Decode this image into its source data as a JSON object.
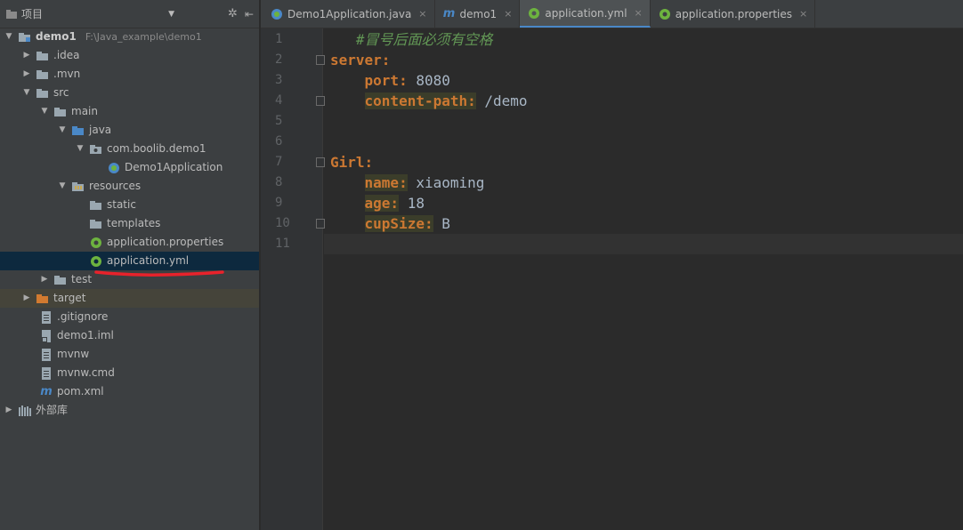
{
  "sidebar": {
    "title": "项目",
    "root": {
      "name": "demo1",
      "path": "F:\\Java_example\\demo1"
    },
    "items": [
      {
        "label": ".idea"
      },
      {
        "label": ".mvn"
      },
      {
        "label": "src"
      },
      {
        "label": "main"
      },
      {
        "label": "java"
      },
      {
        "label": "com.boolib.demo1"
      },
      {
        "label": "Demo1Application"
      },
      {
        "label": "resources"
      },
      {
        "label": "static"
      },
      {
        "label": "templates"
      },
      {
        "label": "application.properties"
      },
      {
        "label": "application.yml"
      },
      {
        "label": "test"
      },
      {
        "label": "target"
      },
      {
        "label": ".gitignore"
      },
      {
        "label": "demo1.iml"
      },
      {
        "label": "mvnw"
      },
      {
        "label": "mvnw.cmd"
      },
      {
        "label": "pom.xml"
      },
      {
        "label": "外部库"
      }
    ]
  },
  "tabs": [
    {
      "label": "Demo1Application.java",
      "close": "×"
    },
    {
      "label": "demo1",
      "close": "×"
    },
    {
      "label": "application.yml",
      "close": "×"
    },
    {
      "label": "application.properties",
      "close": "×"
    }
  ],
  "editor": {
    "line_numbers": [
      "1",
      "2",
      "3",
      "4",
      "5",
      "6",
      "7",
      "8",
      "9",
      "10",
      "11"
    ],
    "lines": {
      "l1_comment": "#冒号后面必须有空格",
      "l2_key": "server:",
      "l3_key": "port:",
      "l3_val": " 8080",
      "l4_key": "content-path:",
      "l4_val": " /demo",
      "l7_key": "Girl:",
      "l8_key": "name:",
      "l8_val": " xiaoming",
      "l9_key": "age:",
      "l9_val": " 18",
      "l10_key": "cupSize:",
      "l10_val": " B"
    }
  },
  "colors": {
    "background": "#2b2b2b",
    "sidebar": "#3c3f41",
    "selection": "#0d293e",
    "key": "#cc7832",
    "comment": "#629755",
    "annotation": "#e8222b"
  }
}
